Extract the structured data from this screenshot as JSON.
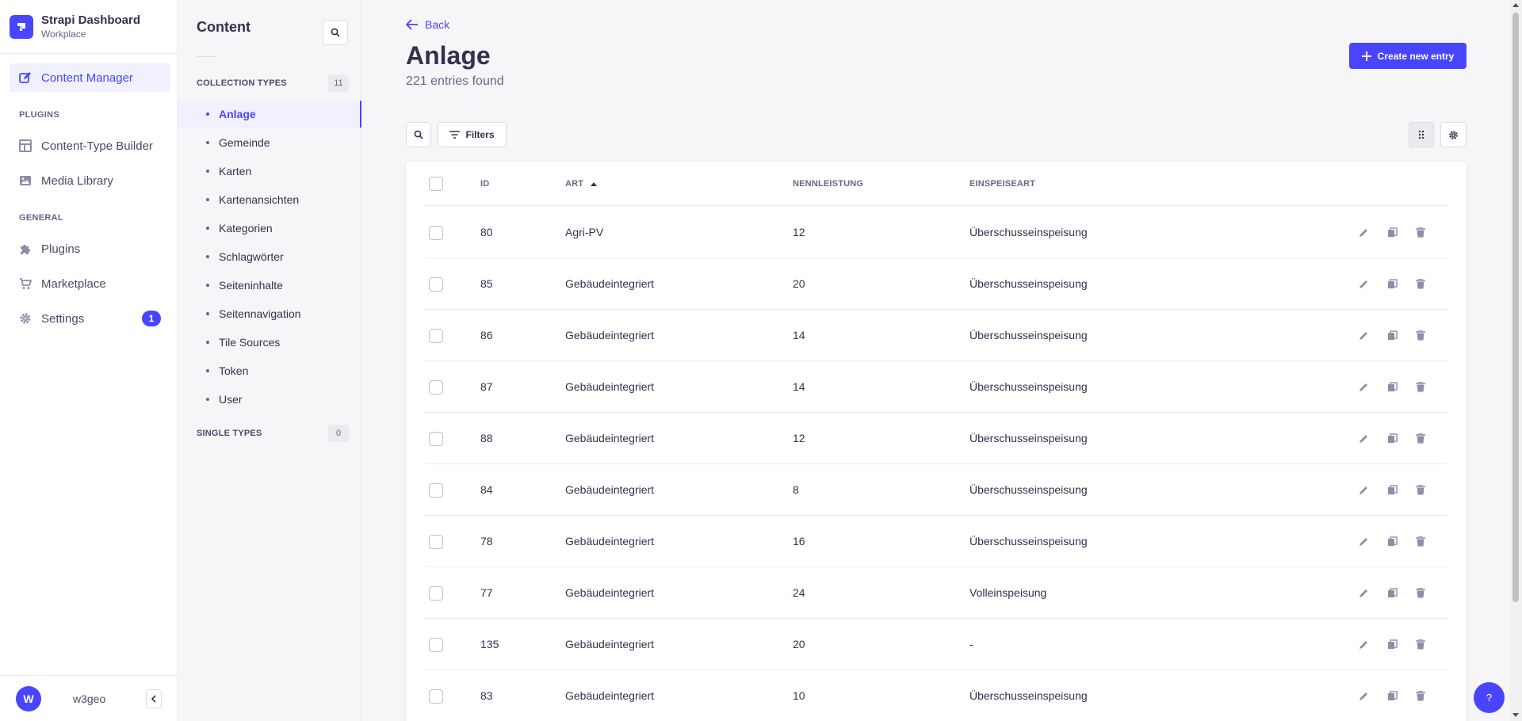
{
  "brand": {
    "title": "Strapi Dashboard",
    "subtitle": "Workplace"
  },
  "mainnav": {
    "active_label": "Content Manager",
    "plugins_heading": "PLUGINS",
    "plugins": [
      "Content-Type Builder",
      "Media Library"
    ],
    "general_heading": "GENERAL",
    "general": [
      "Plugins",
      "Marketplace",
      "Settings"
    ],
    "settings_badge": "1",
    "user_initial": "W",
    "username": "w3geo"
  },
  "subnav": {
    "title": "Content",
    "collection_heading": "COLLECTION TYPES",
    "collection_count": "11",
    "items": [
      "Anlage",
      "Gemeinde",
      "Karten",
      "Kartenansichten",
      "Kategorien",
      "Schlagwörter",
      "Seiteninhalte",
      "Seitennavigation",
      "Tile Sources",
      "Token",
      "User"
    ],
    "active_item": "Anlage",
    "single_heading": "SINGLE TYPES",
    "single_count": "0"
  },
  "header": {
    "back_label": "Back",
    "title": "Anlage",
    "subtitle": "221 entries found",
    "create_label": "Create new entry",
    "filters_label": "Filters"
  },
  "table": {
    "columns": [
      "ID",
      "ART",
      "NENNLEISTUNG",
      "EINSPEISEART"
    ],
    "sorted_column": "ART",
    "rows": [
      {
        "id": "80",
        "art": "Agri-PV",
        "nennleistung": "12",
        "einspeiseart": "Überschusseinspeisung"
      },
      {
        "id": "85",
        "art": "Gebäudeintegriert",
        "nennleistung": "20",
        "einspeiseart": "Überschusseinspeisung"
      },
      {
        "id": "86",
        "art": "Gebäudeintegriert",
        "nennleistung": "14",
        "einspeiseart": "Überschusseinspeisung"
      },
      {
        "id": "87",
        "art": "Gebäudeintegriert",
        "nennleistung": "14",
        "einspeiseart": "Überschusseinspeisung"
      },
      {
        "id": "88",
        "art": "Gebäudeintegriert",
        "nennleistung": "12",
        "einspeiseart": "Überschusseinspeisung"
      },
      {
        "id": "84",
        "art": "Gebäudeintegriert",
        "nennleistung": "8",
        "einspeiseart": "Überschusseinspeisung"
      },
      {
        "id": "78",
        "art": "Gebäudeintegriert",
        "nennleistung": "16",
        "einspeiseart": "Überschusseinspeisung"
      },
      {
        "id": "77",
        "art": "Gebäudeintegriert",
        "nennleistung": "24",
        "einspeiseart": "Volleinspeisung"
      },
      {
        "id": "135",
        "art": "Gebäudeintegriert",
        "nennleistung": "20",
        "einspeiseart": "-"
      },
      {
        "id": "83",
        "art": "Gebäudeintegriert",
        "nennleistung": "10",
        "einspeiseart": "Überschusseinspeisung"
      }
    ]
  },
  "help_label": "?",
  "colors": {
    "primary": "#4945ff",
    "active_bg": "#f0f0ff",
    "text": "#32324d",
    "muted": "#666687"
  }
}
